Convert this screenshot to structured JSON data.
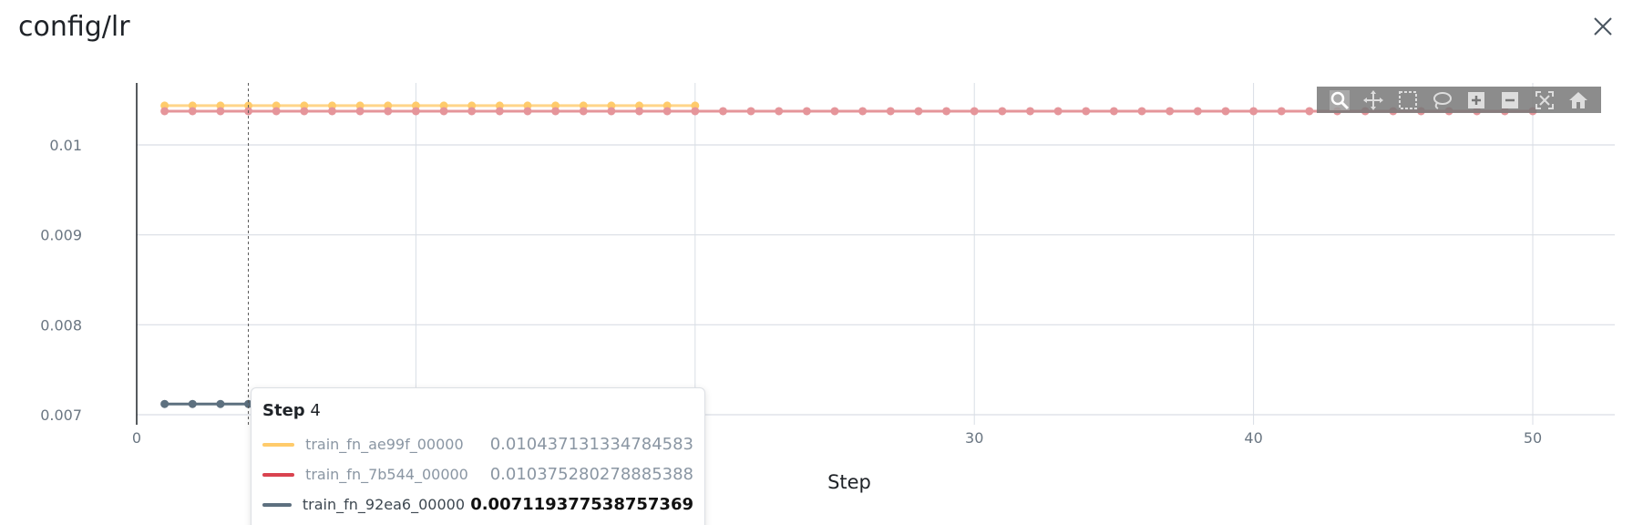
{
  "title": "config/lr",
  "chart_data": {
    "type": "line",
    "xlabel": "Step",
    "ylabel": "",
    "xlim": [
      0,
      53
    ],
    "ylim": [
      0.00695,
      0.01068
    ],
    "x_ticks": [
      0,
      10,
      20,
      30,
      40,
      50
    ],
    "y_ticks": [
      0.007,
      0.008,
      0.009,
      0.01
    ],
    "x_tick_labels": [
      "0",
      "",
      "",
      "30",
      "40",
      "50"
    ],
    "y_tick_labels": [
      "0.007",
      "0.008",
      "0.009",
      "0.01"
    ],
    "grid": true,
    "series": [
      {
        "name": "train_fn_ae99f_00000",
        "color": "#ffcb6b",
        "x_start": 1,
        "x_end": 20,
        "value": 0.010437131334784583
      },
      {
        "name": "train_fn_7b544_00000",
        "color": "#e5959a",
        "x_start": 1,
        "x_end": 50,
        "value": 0.010375280278885388
      },
      {
        "name": "train_fn_92ea6_00000",
        "color": "#5d707f",
        "x_start": 1,
        "x_end": 4,
        "value": 0.007119377538757369
      }
    ],
    "hover_step": 4
  },
  "tooltip": {
    "step_label": "Step",
    "step_value": "4",
    "rows": [
      {
        "name": "train_fn_ae99f_00000",
        "value": "0.010437131334784583",
        "color": "#ffcb6b"
      },
      {
        "name": "train_fn_7b544_00000",
        "value": "0.010375280278885388",
        "color": "#d9434f"
      },
      {
        "name": "train_fn_92ea6_00000",
        "value": "0.007119377538757369",
        "color": "#5d707f"
      }
    ]
  },
  "toolbar": {
    "tools": [
      "zoom-icon",
      "pan-icon",
      "box-select-icon",
      "lasso-icon",
      "zoom-in-icon",
      "zoom-out-icon",
      "autoscale-icon",
      "reset-home-icon"
    ]
  }
}
